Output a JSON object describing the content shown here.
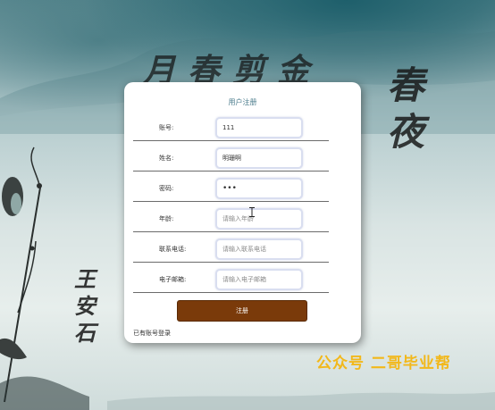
{
  "background": {
    "poem_title": "月春剪金",
    "poem_side": [
      "春",
      "夜"
    ],
    "author": [
      "王",
      "安",
      "石"
    ],
    "watermark": "公众号 二哥毕业帮"
  },
  "form": {
    "title": "用户注册",
    "fields": [
      {
        "label": "账号:",
        "value": "111",
        "placeholder": ""
      },
      {
        "label": "姓名:",
        "value": "明珊啊",
        "placeholder": ""
      },
      {
        "label": "密码:",
        "value": "•••",
        "placeholder": ""
      },
      {
        "label": "年龄:",
        "value": "",
        "placeholder": "请输入年龄"
      },
      {
        "label": "联系电话:",
        "value": "",
        "placeholder": "请输入联系电话"
      },
      {
        "label": "电子邮箱:",
        "value": "",
        "placeholder": "请输入电子邮箱"
      }
    ],
    "submit_label": "注册",
    "login_link": "已有账号登录"
  },
  "colors": {
    "button_bg": "#7a3a0a",
    "title_color": "#4b7c8c",
    "watermark": "#f2b81b"
  }
}
